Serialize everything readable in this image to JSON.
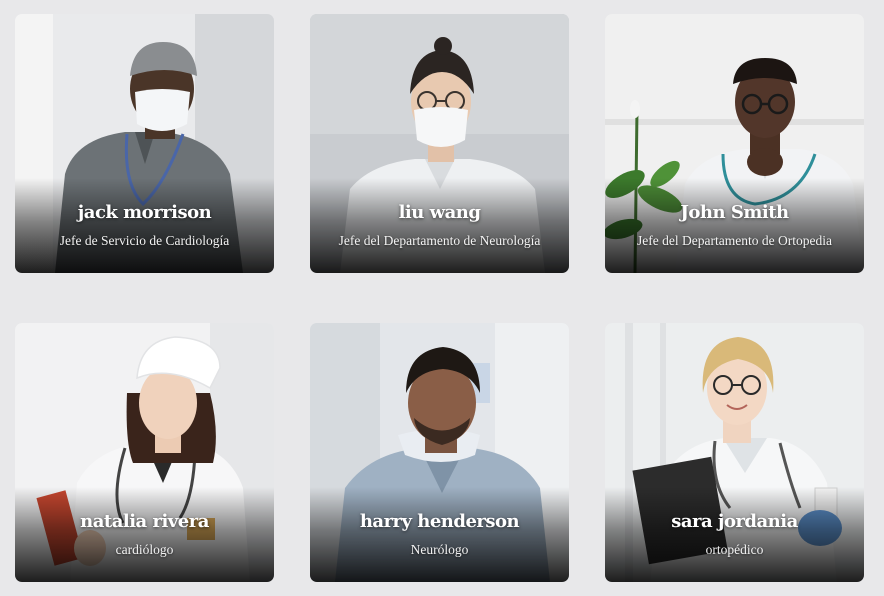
{
  "doctors": [
    {
      "name": "jack morrison",
      "role": "Jefe de Servicio de Cardiología",
      "photo_icon": "doctor-photo"
    },
    {
      "name": "liu wang",
      "role": "Jefe del Departamento de Neurología",
      "photo_icon": "doctor-photo"
    },
    {
      "name": "John Smith",
      "role": "Jefe del Departamento de Ortopedia",
      "photo_icon": "doctor-photo"
    },
    {
      "name": "natalia rivera",
      "role": "cardiólogo",
      "photo_icon": "doctor-photo"
    },
    {
      "name": "harry henderson",
      "role": "Neurólogo",
      "photo_icon": "doctor-photo"
    },
    {
      "name": "sara jordania",
      "role": "ortopédico",
      "photo_icon": "doctor-photo"
    }
  ],
  "colors": {
    "page_background": "#e8e8ea",
    "text": "#ffffff"
  }
}
